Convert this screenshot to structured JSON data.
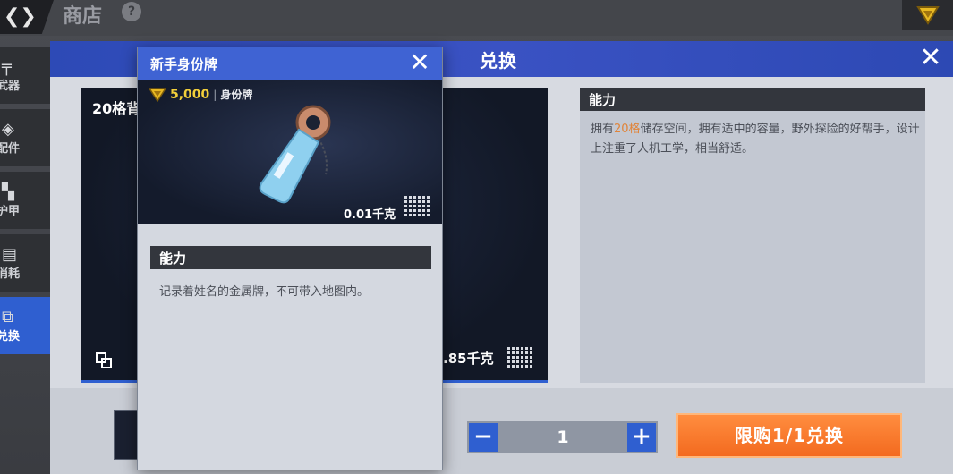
{
  "shop": {
    "title": "商店",
    "help_icon": "help-icon",
    "sidebar": [
      {
        "label": "武器",
        "icon": "gun-icon",
        "active": false
      },
      {
        "label": "配件",
        "icon": "attachment-icon",
        "active": false
      },
      {
        "label": "护甲",
        "icon": "armor-icon",
        "active": false
      },
      {
        "label": "消耗",
        "icon": "consumable-icon",
        "active": false
      },
      {
        "label": "兑换",
        "icon": "exchange-icon",
        "active": true
      }
    ]
  },
  "exchange": {
    "title": "兑换",
    "item_name": "20格背",
    "item_weight": ".85千克",
    "ability_header": "能力",
    "description_prefix": "拥有",
    "description_highlight": "20格",
    "description_suffix": "储存空间，拥有适中的容量，野外探险的好帮手，设计上注重了人机工学，相当舒适。",
    "quantity": "1",
    "minus_label": "−",
    "plus_label": "+",
    "buy_button": "限购1/1兑换"
  },
  "popup": {
    "title": "新手身份牌",
    "price": "5,000",
    "price_separator": "|",
    "price_unit": "身份牌",
    "weight": "0.01千克",
    "ability_header": "能力",
    "description": "记录着姓名的金属牌，不可带入地图内。"
  },
  "colors": {
    "accent_blue": "#3f63d3",
    "buy_orange": "#f36a1f",
    "highlight_orange": "#e0843a",
    "price_gold": "#f2cf3a"
  }
}
